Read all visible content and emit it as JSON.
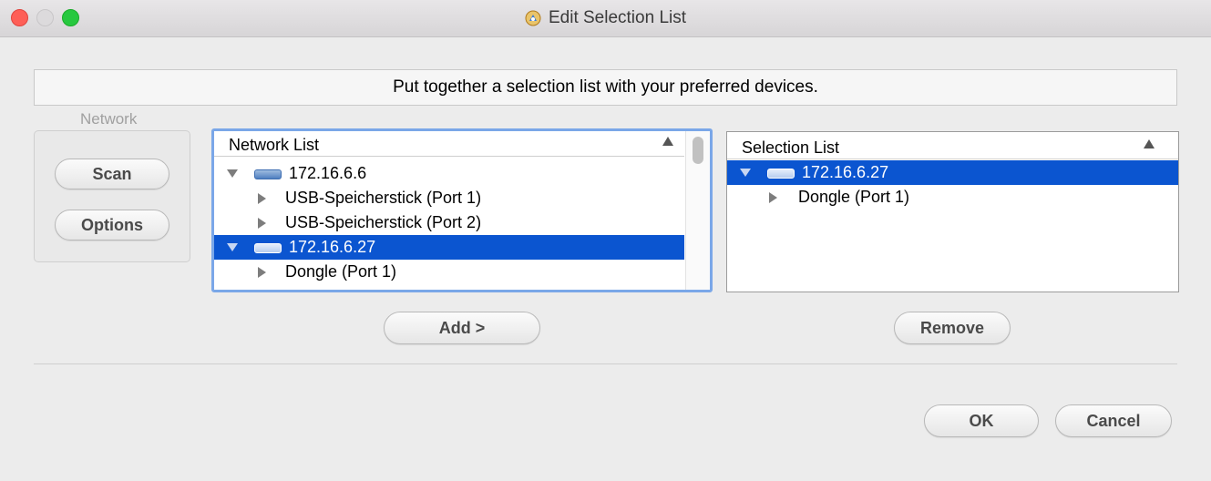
{
  "window": {
    "title": "Edit Selection List"
  },
  "banner": {
    "text": "Put together a selection list with your preferred devices."
  },
  "network_group": {
    "label": "Network",
    "scan_label": "Scan",
    "options_label": "Options"
  },
  "network_list": {
    "header": "Network List",
    "rows": [
      {
        "text": "172.16.6.6",
        "kind": "device",
        "expanded": true,
        "selected": false
      },
      {
        "text": "USB-Speicherstick (Port 1)",
        "kind": "port",
        "selected": false
      },
      {
        "text": "USB-Speicherstick (Port 2)",
        "kind": "port",
        "selected": false
      },
      {
        "text": "172.16.6.27",
        "kind": "device",
        "expanded": true,
        "selected": true
      },
      {
        "text": "Dongle (Port 1)",
        "kind": "port",
        "selected": false
      }
    ]
  },
  "selection_list": {
    "header": "Selection List",
    "rows": [
      {
        "text": "172.16.6.27",
        "kind": "device",
        "expanded": true,
        "selected": true
      },
      {
        "text": "Dongle (Port 1)",
        "kind": "port",
        "selected": false
      }
    ]
  },
  "actions": {
    "add_label": "Add >",
    "remove_label": "Remove",
    "ok_label": "OK",
    "cancel_label": "Cancel"
  },
  "colors": {
    "selection": "#0b55d0",
    "focus_ring": "#7aa7e8",
    "close": "#fe5f57",
    "zoom": "#27c83f"
  }
}
